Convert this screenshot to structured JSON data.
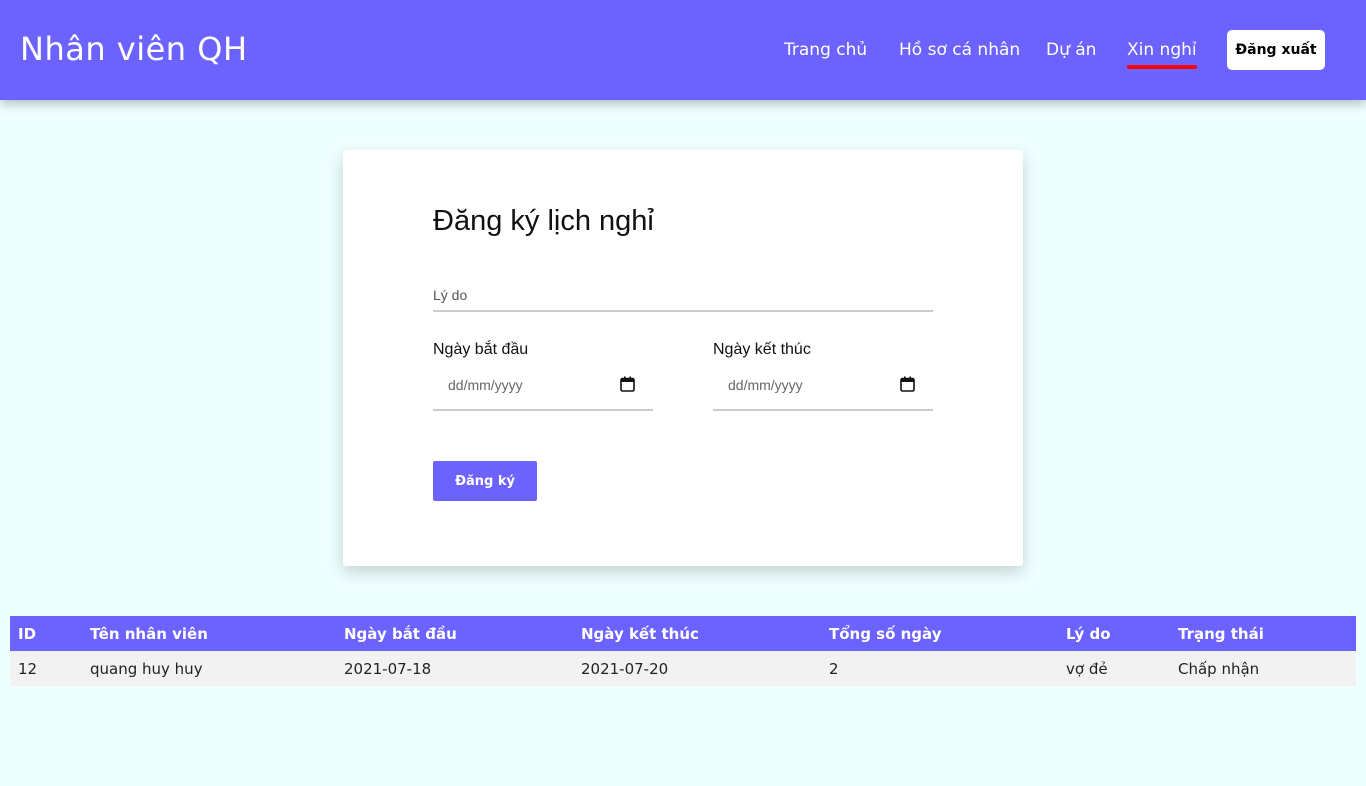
{
  "header": {
    "brand": "Nhân viên QH",
    "nav": [
      "Trang chủ",
      "Hồ sơ cá nhân",
      "Dự án",
      "Xin nghỉ"
    ],
    "active_nav": "Xin nghỉ",
    "logout_label": "Đăng xuất",
    "bg_color": "#6c63ff",
    "active_underline_color": "#ff0000"
  },
  "form": {
    "title": "Đăng ký lịch nghỉ",
    "reason_placeholder": "Lý do",
    "start_label": "Ngày bắt đầu",
    "end_label": "Ngày kết thúc",
    "date_placeholder": "dd/mm/yyyy",
    "submit_label": "Đăng ký"
  },
  "table": {
    "headers": [
      "ID",
      "Tên nhân viên",
      "Ngày bắt đầu",
      "Ngày kết thúc",
      "Tổng số ngày",
      "Lý do",
      "Trạng thái"
    ],
    "rows": [
      [
        "12",
        "quang huy huy",
        "2021-07-18",
        "2021-07-20",
        "2",
        "vợ đẻ",
        "Chấp nhận"
      ]
    ]
  }
}
